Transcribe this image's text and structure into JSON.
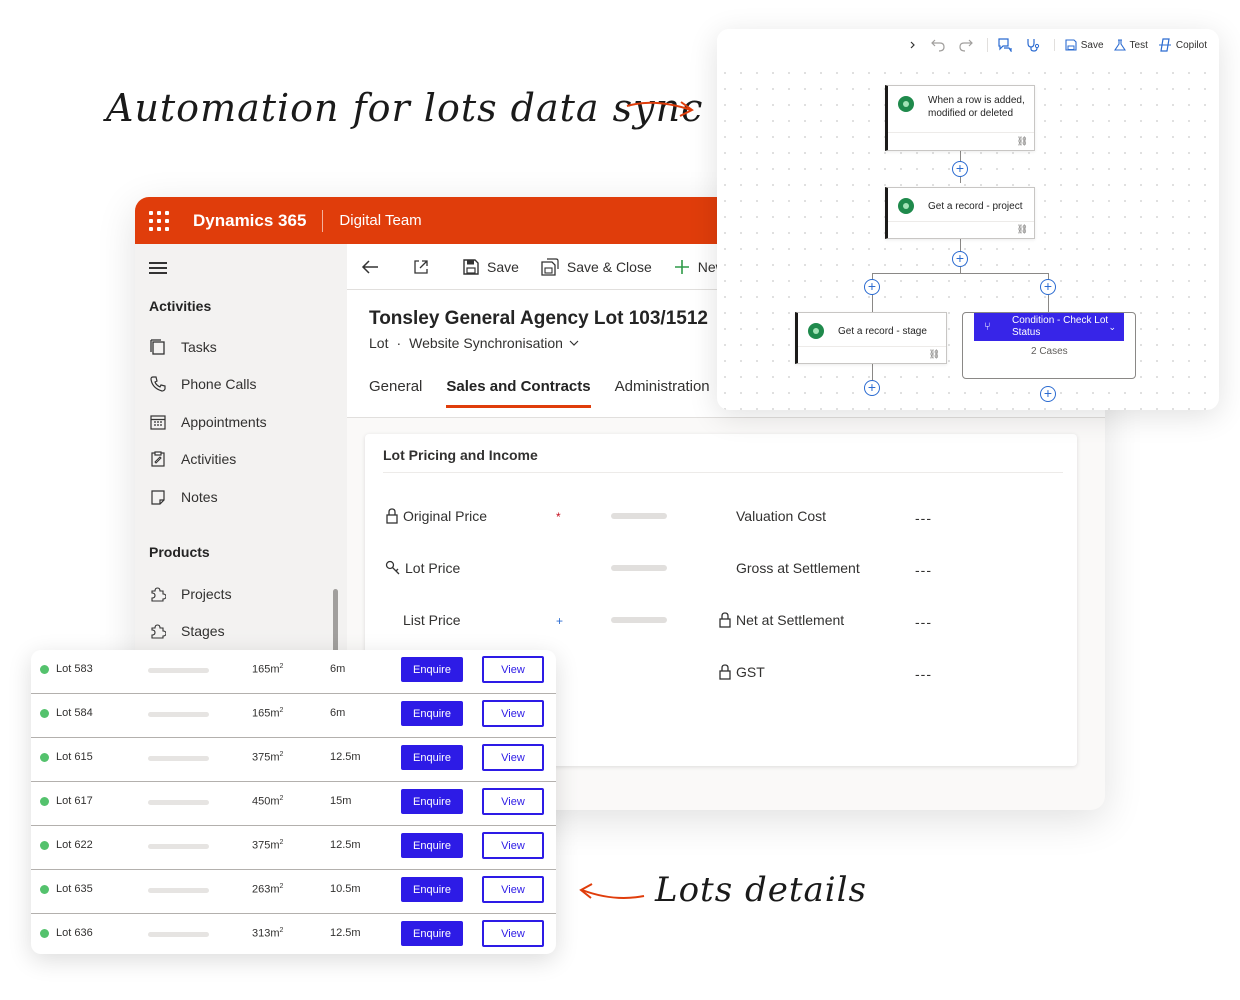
{
  "annotations": {
    "top": "Automation for lots data sync",
    "bottom": "Lots details"
  },
  "d365": {
    "app_title": "Dynamics 365",
    "team": "Digital Team",
    "accent": "#e03d0b",
    "sidebar": {
      "sections": [
        {
          "title": "Activities",
          "items": [
            {
              "label": "Tasks",
              "icon": "tasks-icon"
            },
            {
              "label": "Phone Calls",
              "icon": "phone-icon"
            },
            {
              "label": "Appointments",
              "icon": "calendar-icon"
            },
            {
              "label": "Activities",
              "icon": "clipboard-icon"
            },
            {
              "label": "Notes",
              "icon": "note-icon"
            }
          ]
        },
        {
          "title": "Products",
          "items": [
            {
              "label": "Projects",
              "icon": "puzzle-icon"
            },
            {
              "label": "Stages",
              "icon": "puzzle-icon"
            }
          ]
        }
      ]
    },
    "commands": {
      "save": "Save",
      "save_close": "Save & Close",
      "new": "New"
    },
    "record": {
      "title": "Tonsley General Agency Lot 103/1512",
      "entity": "Lot",
      "dot": "·",
      "form": "Website Synchronisation"
    },
    "tabs": [
      "General",
      "Sales and Contracts",
      "Administration"
    ],
    "active_tab": "Sales and Contracts",
    "card": {
      "title": "Lot Pricing and Income",
      "left_fields": [
        {
          "label": "Original Price",
          "icon": "lock-icon",
          "required": "*"
        },
        {
          "label": "Lot Price",
          "icon": "key-icon",
          "required": ""
        },
        {
          "label": "List Price",
          "icon": "",
          "required": "+"
        }
      ],
      "right_fields": [
        {
          "label": "Valuation Cost",
          "icon": "",
          "value": "---"
        },
        {
          "label": "Gross at Settlement",
          "icon": "",
          "value": "---"
        },
        {
          "label": "Net at Settlement",
          "icon": "lock-icon",
          "value": "---"
        },
        {
          "label": "GST",
          "icon": "lock-icon",
          "value": "---"
        }
      ]
    }
  },
  "flow": {
    "toolbar": {
      "save": "Save",
      "test": "Test",
      "copilot": "Copilot"
    },
    "nodes": {
      "trigger": "When a row is added, modified or deleted",
      "get_project": "Get a record - project",
      "get_stage": "Get a record - stage",
      "condition": "Condition - Check Lot Status",
      "cases": "2 Cases"
    },
    "condition_color": "#3725e8"
  },
  "lots": {
    "enquire_label": "Enquire",
    "view_label": "View",
    "area_unit": "m",
    "area_exp": "2",
    "rows": [
      {
        "name": "Lot 583",
        "area": "165",
        "frontage": "6m"
      },
      {
        "name": "Lot 584",
        "area": "165",
        "frontage": "6m"
      },
      {
        "name": "Lot 615",
        "area": "375",
        "frontage": "12.5m"
      },
      {
        "name": "Lot 617",
        "area": "450",
        "frontage": "15m"
      },
      {
        "name": "Lot 622",
        "area": "375",
        "frontage": "12.5m"
      },
      {
        "name": "Lot 635",
        "area": "263",
        "frontage": "10.5m"
      },
      {
        "name": "Lot 636",
        "area": "313",
        "frontage": "12.5m"
      }
    ]
  }
}
